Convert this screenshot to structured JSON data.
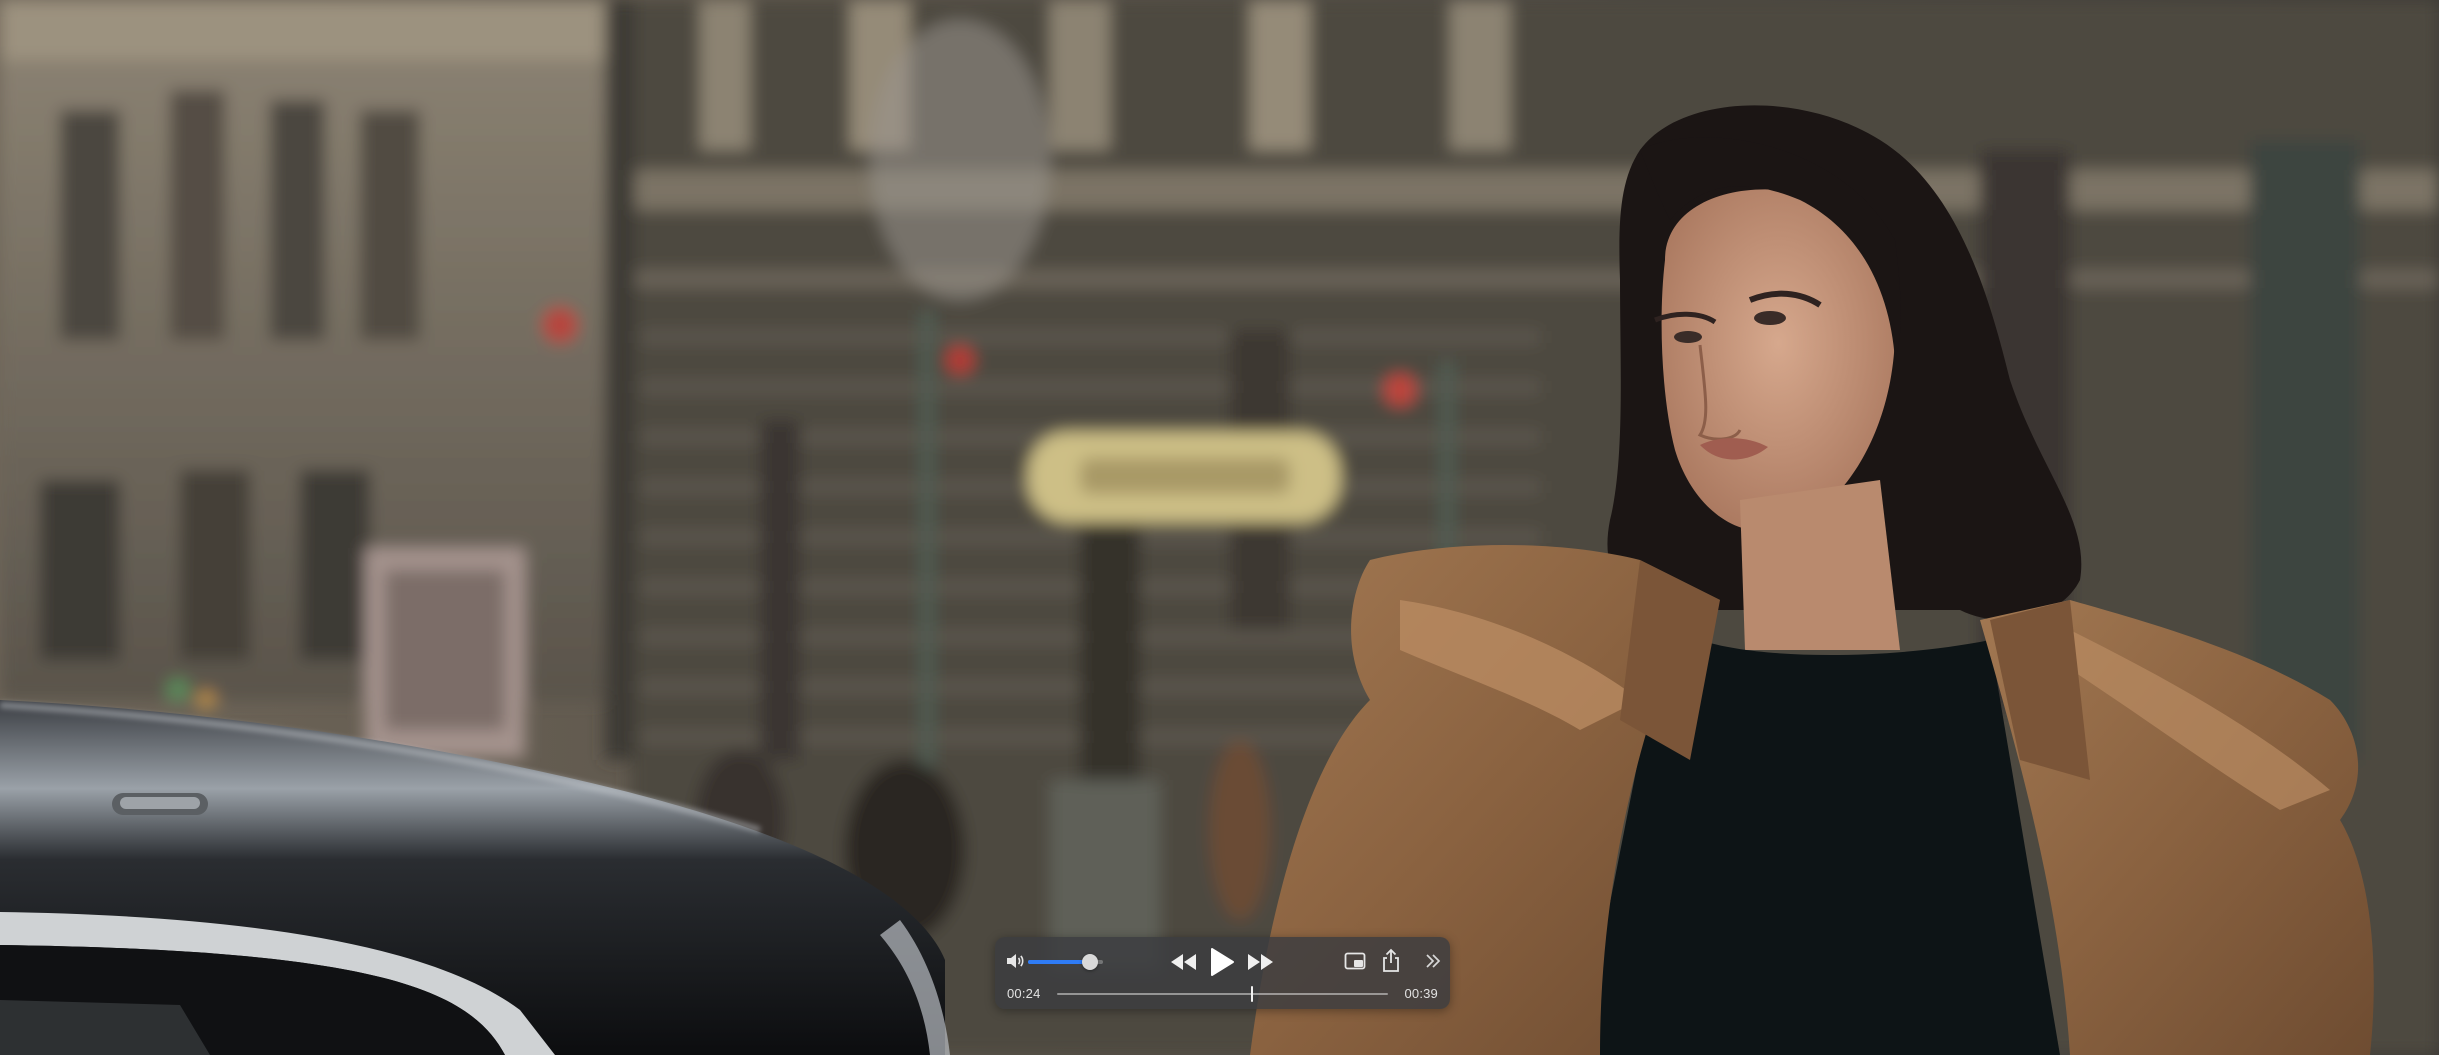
{
  "player": {
    "accent_color": "#2f7cf6",
    "volume_level": 0.82,
    "playback_state": "paused",
    "time": {
      "elapsed": "00:24",
      "remaining": "00:39",
      "progress": 0.59
    },
    "controls": {
      "volume_icon": "speaker-icon",
      "rewind_icon": "rewind-icon",
      "play_icon": "play-icon",
      "forward_icon": "fast-forward-icon",
      "pip_icon": "picture-in-picture-icon",
      "share_icon": "share-icon",
      "more_icon": "chevron-double-right-icon"
    }
  }
}
